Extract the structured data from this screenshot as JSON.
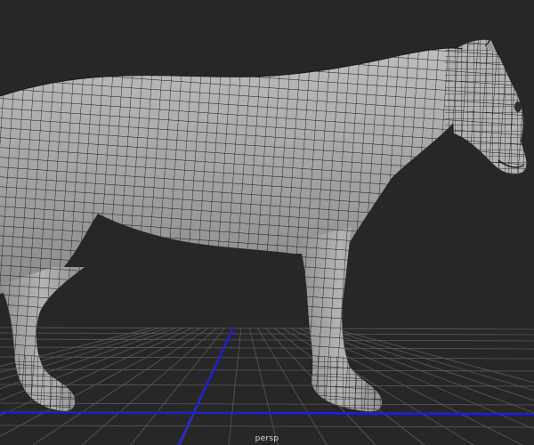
{
  "viewport": {
    "camera_name": "persp",
    "background": "#272727",
    "grid_color": "#5a5a5a",
    "axis_color": "#1f1fd6",
    "mesh_fill": "#a3a3a3",
    "mesh_wire": "#1a1a1a",
    "object": "big-cat-quad-mesh"
  }
}
